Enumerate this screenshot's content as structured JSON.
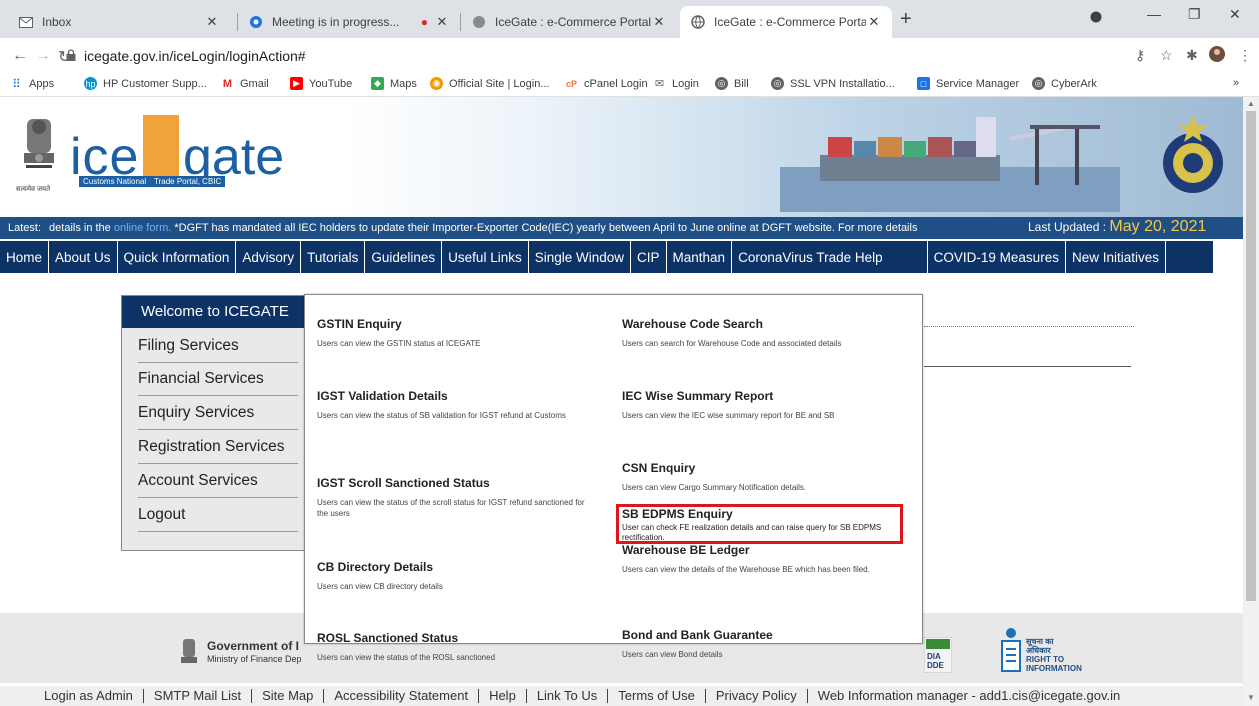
{
  "browser": {
    "tabs": [
      {
        "title": "Inbox",
        "icon": "mail-icon",
        "active": false
      },
      {
        "title": "Meeting is in progress...",
        "icon": "meeting-icon",
        "active": false
      },
      {
        "title": "IceGate : e-Commerce Portal of C",
        "icon": "icegate-icon",
        "active": false
      },
      {
        "title": "IceGate : e-Commerce Portal of C",
        "icon": "globe-icon",
        "active": true
      }
    ],
    "url": "icegate.gov.in/iceLogin/loginAction#",
    "bookmarks": [
      "Apps",
      "HP Customer Supp...",
      "Gmail",
      "YouTube",
      "Maps",
      "Official Site | Login...",
      "cPanel Login",
      "Login",
      "Bill",
      "SSL VPN Installatio...",
      "Service Manager",
      "CyberArk"
    ],
    "bookmarks_more": "»"
  },
  "banner": {
    "logo_ice": "ice",
    "logo_gate": "gate",
    "logo_sub1": "Customs National",
    "logo_sub2": "Trade Portal, CBIC",
    "emblem_caption": "सत्यमेव जयते"
  },
  "ticker": {
    "label": "Latest:",
    "text_before": "details in the",
    "link": "online form.",
    "text_after": "*DGFT has mandated all IEC holders to update their Importer-Exporter Code(IEC) yearly between April to June online at DGFT website. For more details",
    "updated_label": "Last Updated :",
    "updated_date": "May 20, 2021"
  },
  "mainnav": [
    "Home",
    "About Us",
    "Quick Information",
    "Advisory",
    "Tutorials",
    "Guidelines",
    "Useful Links",
    "Single Window",
    "CIP",
    "Manthan",
    "CoronaVirus Trade Help",
    "COVID-19 Measures",
    "New Initiatives"
  ],
  "welcome": {
    "title": "Welcome to ICEGATE",
    "items": [
      "Filing Services",
      "Financial Services",
      "Enquiry Services",
      "Registration Services",
      "Account Services",
      "Logout"
    ]
  },
  "mega": {
    "items": [
      {
        "title": "GSTIN Enquiry",
        "desc": "Users can view the GSTIN status at ICEGATE"
      },
      {
        "title": "Warehouse Code Search",
        "desc": "Users can search for Warehouse Code and associated details"
      },
      {
        "title": "IGST Validation Details",
        "desc": "Users can view the status of SB validation for IGST refund at Customs"
      },
      {
        "title": "IEC Wise Summary Report",
        "desc": "Users can view the IEC wise summary report for BE and SB"
      },
      {
        "title": "CSN Enquiry",
        "desc": "Users can view Cargo Summary Notification details."
      },
      {
        "title": "IGST Scroll Sanctioned Status",
        "desc": "Users can view the status of the scroll status for IGST refund sanctioned for the users"
      },
      {
        "title": "SB EDPMS Enquiry",
        "desc": "User can check FE realization details and can raise query for SB EDPMS rectification."
      },
      {
        "title": "Warehouse BE Ledger",
        "desc": "Users can view the details of the Warehouse BE which has been filed."
      },
      {
        "title": "CB Directory Details",
        "desc": "Users can view CB directory details"
      },
      {
        "title": "ROSL Sanctioned Status",
        "desc": "Users can view the status of the ROSL sanctioned"
      },
      {
        "title": "Bond and Bank Guarantee",
        "desc": "Users can view Bond details"
      }
    ]
  },
  "footer": {
    "gov_title": "Government of I",
    "gov_sub": "Ministry of Finance Dep",
    "dindia": "DIA\nDDE",
    "rti_lines": [
      "सूचना का",
      "अधिकार",
      "RIGHT TO",
      "INFORMATION"
    ],
    "links": [
      "Login as Admin",
      "SMTP Mail List",
      "Site Map",
      "Accessibility Statement",
      "Help",
      "Link To Us",
      "Terms of Use",
      "Privacy Policy",
      "Web Information manager - add1.cis@icegate.gov.in"
    ]
  },
  "colors": {
    "nav": "#0d3366",
    "ticker": "#1f4f85",
    "highlight": "#e0141e",
    "logo_blue": "#1d5fa3",
    "logo_orange": "#f2a23a"
  }
}
